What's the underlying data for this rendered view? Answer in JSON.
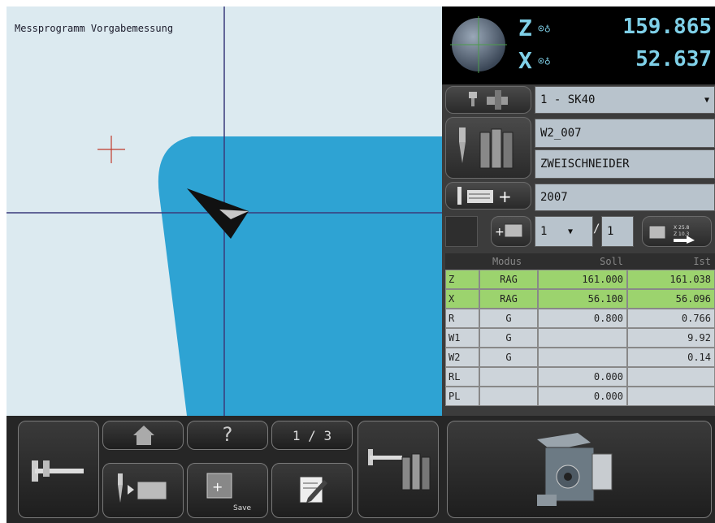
{
  "canvas": {
    "title": "Messprogramm Vorgabemessung",
    "colors": {
      "background": "#dceaf0",
      "part": "#2ea3d3",
      "crosshair": "#3a3a7a",
      "target_mark": "#c0392b"
    }
  },
  "dro": {
    "axes": [
      {
        "axis": "Z",
        "mode": "⊙♁",
        "value": "159.865"
      },
      {
        "axis": "X",
        "mode": "⊙♁",
        "value": "52.637"
      }
    ],
    "color": "#7fd0e8"
  },
  "tool": {
    "holder": "1 - SK40",
    "name": "W2_007",
    "type": "ZWEISCHNEIDER",
    "number": "2007",
    "page_current": "1",
    "page_separator": "/",
    "page_total": "1"
  },
  "table": {
    "headers": [
      "",
      "Modus",
      "Soll",
      "Ist"
    ],
    "rows": [
      {
        "name": "Z",
        "modus": "RAG",
        "soll": "161.000",
        "ist": "161.038",
        "highlight": true
      },
      {
        "name": "X",
        "modus": "RAG",
        "soll": "56.100",
        "ist": "56.096",
        "highlight": true
      },
      {
        "name": "R",
        "modus": "G",
        "soll": "0.800",
        "ist": "0.766",
        "highlight": false
      },
      {
        "name": "W1",
        "modus": "G",
        "soll": "",
        "ist": "9.92",
        "highlight": false
      },
      {
        "name": "W2",
        "modus": "G",
        "soll": "",
        "ist": "0.14",
        "highlight": false
      },
      {
        "name": "RL",
        "modus": "",
        "soll": "0.000",
        "ist": "",
        "highlight": false
      },
      {
        "name": "PL",
        "modus": "",
        "soll": "0.000",
        "ist": "",
        "highlight": false
      }
    ]
  },
  "toolbar": {
    "help_label": "?",
    "page_label": "1 / 3",
    "save_label": "Save"
  },
  "icons": [
    "measure-caliper-icon",
    "home-icon",
    "help-icon",
    "tool-to-screen-icon",
    "save-icon",
    "edit-icon",
    "caliper-toolset-icon",
    "machine-preview-image",
    "dro-sphere-icon",
    "tool-holder-icon",
    "tool-library-icon",
    "add-list-icon",
    "add-program-icon",
    "transfer-values-icon",
    "dropdown-arrow-icon"
  ]
}
